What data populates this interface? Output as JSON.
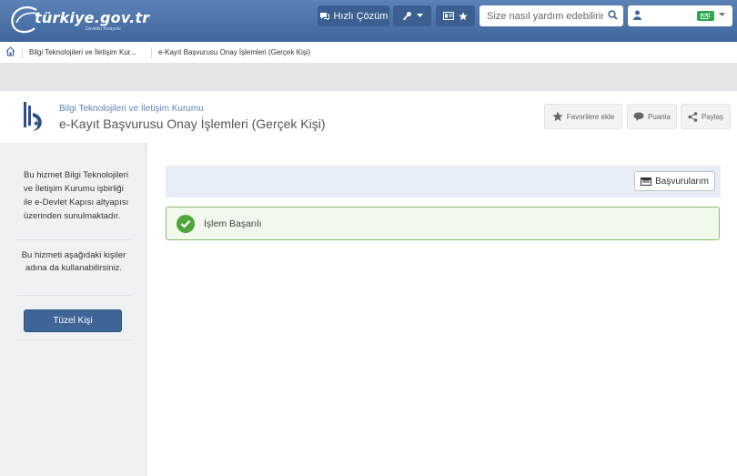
{
  "topbar": {
    "logo_text": "türkiye.gov.tr",
    "logo_sub": "Devletin Kısayolu",
    "hizli_cozum_label": "Hızlı Çözüm",
    "search_placeholder": "Size nasıl yardım edebilirim?",
    "mail_count": "1"
  },
  "breadcrumb": {
    "items": [
      "Bilgi Teknolojileri ve İletişim Kur...",
      "e-Kayıt Başvurusu Onay İşlemleri (Gerçek Kişi)"
    ]
  },
  "header": {
    "institution": "Bilgi Teknolojileri ve İletişim Kurumu",
    "service_title": "e-Kayıt Başvurusu Onay İşlemleri (Gerçek Kişi)",
    "favorite_label": "Favorilere ekle",
    "rate_label": "Puanla",
    "share_label": "Paylaş"
  },
  "sidebar": {
    "info_text": "Bu hizmet Bilgi Teknolojileri ve İletişim Kurumu işbirliği ile e-Devlet Kapısı altyapısı üzerinden sunulmaktadır.",
    "on_behalf_text": "Bu hizmeti aşağıdaki kişiler adına da kullanabilirsiniz.",
    "tuzel_kisi_label": "Tüzel Kişi"
  },
  "main": {
    "basvurularim_label": "Başvurularım",
    "success_message": "İşlem Başarılı"
  },
  "colors": {
    "topbar": "#4a73a8",
    "primary_button": "#3d6596",
    "success_border": "#86c06a",
    "success_icon": "#4fa53a"
  }
}
